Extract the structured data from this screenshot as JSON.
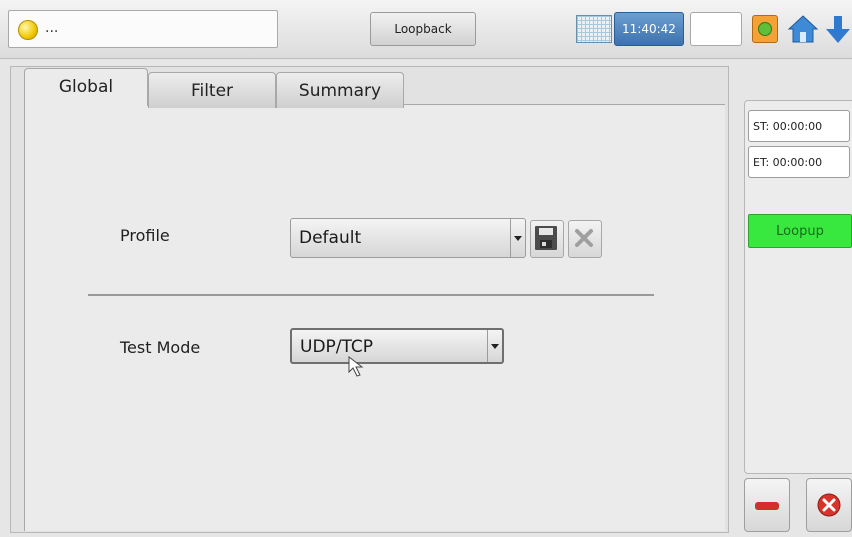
{
  "topbar": {
    "status_text": "...",
    "mode_button_label": "Loopback",
    "clock_time": "11:40:42",
    "icons": [
      "status-indicator-icon",
      "grid-icon",
      "tool-icon",
      "home-icon",
      "down-arrow-icon"
    ]
  },
  "tabs": [
    {
      "label": "Global",
      "active": true
    },
    {
      "label": "Filter",
      "active": false
    },
    {
      "label": "Summary",
      "active": false
    }
  ],
  "form": {
    "profile_label": "Profile",
    "profile_value": "Default",
    "test_mode_label": "Test Mode",
    "test_mode_value": "UDP/TCP"
  },
  "side_panel": {
    "start_time": "ST:  00:00:00",
    "end_time": "ET:  00:00:00",
    "loopup_label": "Loopup"
  },
  "colors": {
    "accent_clock": "#4a82c0",
    "loopup_green": "#39e83f",
    "close_red": "#d9342b"
  }
}
